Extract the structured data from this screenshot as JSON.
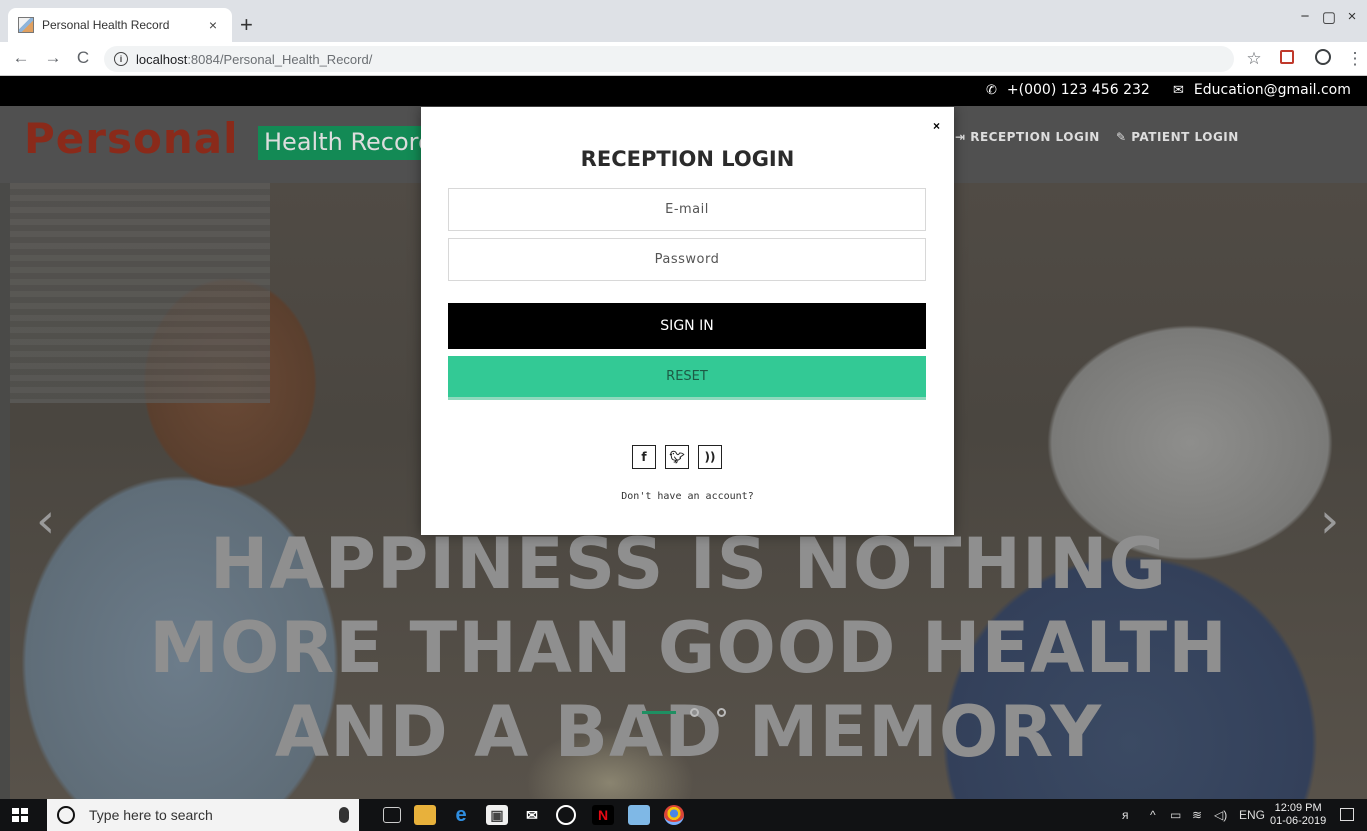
{
  "browser": {
    "tab_title": "Personal Health Record",
    "tab_close": "×",
    "new_tab": "+",
    "url_host": "localhost",
    "url_path": ":8084/Personal_Health_Record/",
    "back": "←",
    "forward": "→",
    "reload": "C",
    "minimize": "−",
    "maximize": "▢",
    "close": "×",
    "star": "☆",
    "menu": "⋮"
  },
  "topbar": {
    "phone": "+(000) 123 456 232",
    "email": "Education@gmail.com"
  },
  "header": {
    "brand_main": "Personal",
    "brand_sub": "Health Record",
    "nav": [
      "RECEPTION LOGIN",
      "PATIENT LOGIN"
    ]
  },
  "hero": {
    "line1": "HAPPINESS IS NOTHING",
    "line2": "MORE THAN GOOD HEALTH",
    "line3": "AND A BAD MEMORY",
    "slide_index": 1,
    "slide_count": 3
  },
  "modal": {
    "close": "×",
    "title": "RECEPTION LOGIN",
    "email_placeholder": "E-mail",
    "password_placeholder": "Password",
    "signin_label": "SIGN IN",
    "reset_label": "RESET",
    "socials": [
      "f",
      "y",
      "rss"
    ],
    "no_account": "Don't have an account?"
  },
  "taskbar": {
    "search_placeholder": "Type here to search",
    "lang": "ENG",
    "time": "12:09 PM",
    "date": "01-06-2019"
  },
  "colors": {
    "brand_red": "#8a2a1a",
    "brand_green": "#138a55",
    "reset_green": "#33c995",
    "signin_black": "#000000"
  }
}
